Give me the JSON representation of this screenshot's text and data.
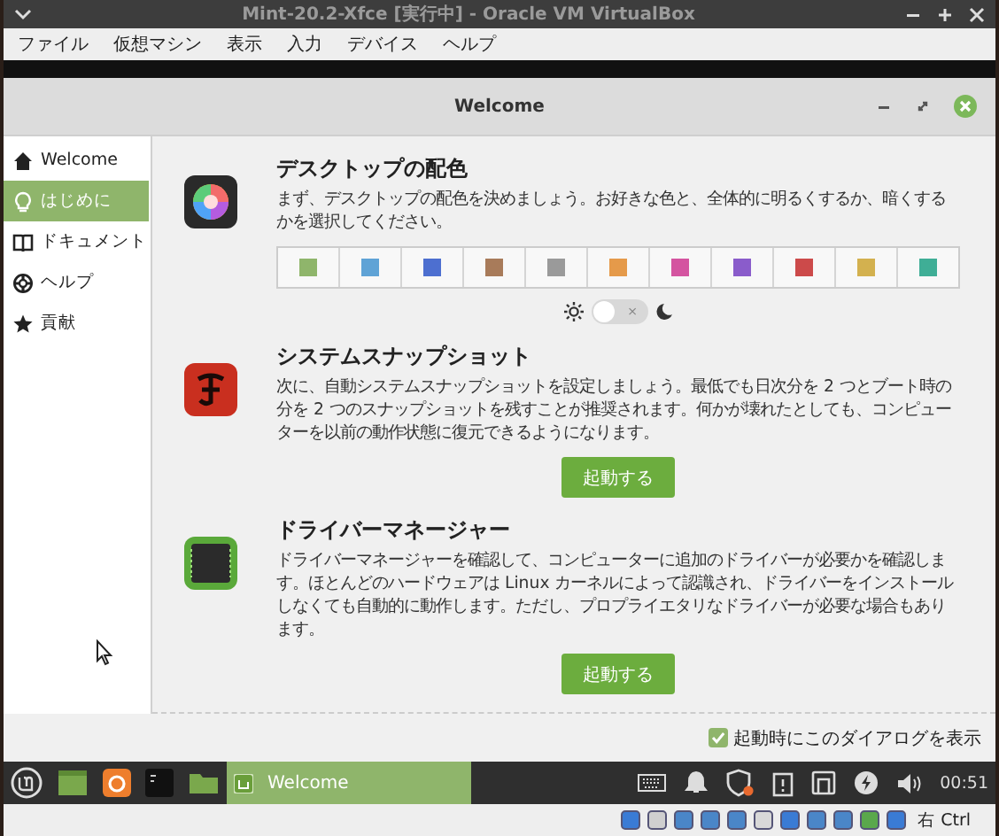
{
  "host_window": {
    "title": "Mint-20.2-Xfce [実行中] - Oracle VM VirtualBox"
  },
  "menu_bar": [
    "ファイル",
    "仮想マシン",
    "表示",
    "入力",
    "デバイス",
    "ヘルプ"
  ],
  "app_window": {
    "title": "Welcome"
  },
  "sidebar": {
    "items": [
      {
        "label": "Welcome",
        "selected": false
      },
      {
        "label": "はじめに",
        "selected": true
      },
      {
        "label": "ドキュメント",
        "selected": false
      },
      {
        "label": "ヘルプ",
        "selected": false
      },
      {
        "label": "貢献",
        "selected": false
      }
    ]
  },
  "sections": [
    {
      "kind": "colors",
      "title": "デスクトップの配色",
      "description": "まず、デスクトップの配色を決めましょう。お好きな色と、全体的に明るくするか、暗くするかを選択してください。",
      "swatches": [
        {
          "color": "#8fb56b",
          "selected": false
        },
        {
          "color": "#5fa3d6",
          "selected": false
        },
        {
          "color": "#4d6fd0",
          "selected": false
        },
        {
          "color": "#a87b5a",
          "selected": false
        },
        {
          "color": "#9a9a9a",
          "selected": false
        },
        {
          "color": "#e59a4a",
          "selected": false
        },
        {
          "color": "#d454a0",
          "selected": false
        },
        {
          "color": "#8a5ccb",
          "selected": false
        },
        {
          "color": "#cc4a4a",
          "selected": false
        },
        {
          "color": "#d3b14f",
          "selected": false
        },
        {
          "color": "#3fae96",
          "selected": false
        }
      ],
      "dark_mode": {
        "on": false,
        "off_mark": "×"
      }
    },
    {
      "kind": "launch",
      "title": "システムスナップショット",
      "description": "次に、自動システムスナップショットを設定しましょう。最低でも日次分を 2 つとブート時の分を 2 つのスナップショットを残すことが推奨されます。何かが壊れたとしても、コンピューターを以前の動作状態に復元できるようになります。",
      "button": "起動する"
    },
    {
      "kind": "launch",
      "title": "ドライバーマネージャー",
      "description": "ドライバーマネージャーを確認して、コンピューターに追加のドライバーが必要かを確認します。ほとんどのハードウェアは Linux カーネルによって認識され、ドライバーをインストールしなくても自動的に動作します。ただし、プロプライエタリなドライバーが必要な場合もあります。",
      "button": "起動する"
    }
  ],
  "footer": {
    "checkbox": {
      "label": "起動時にこのダイアログを表示",
      "checked": true
    }
  },
  "taskbar": {
    "task": {
      "label": "Welcome",
      "selected": true
    },
    "clock": "00:51"
  },
  "vm_status": {
    "host_key": "右 Ctrl"
  }
}
